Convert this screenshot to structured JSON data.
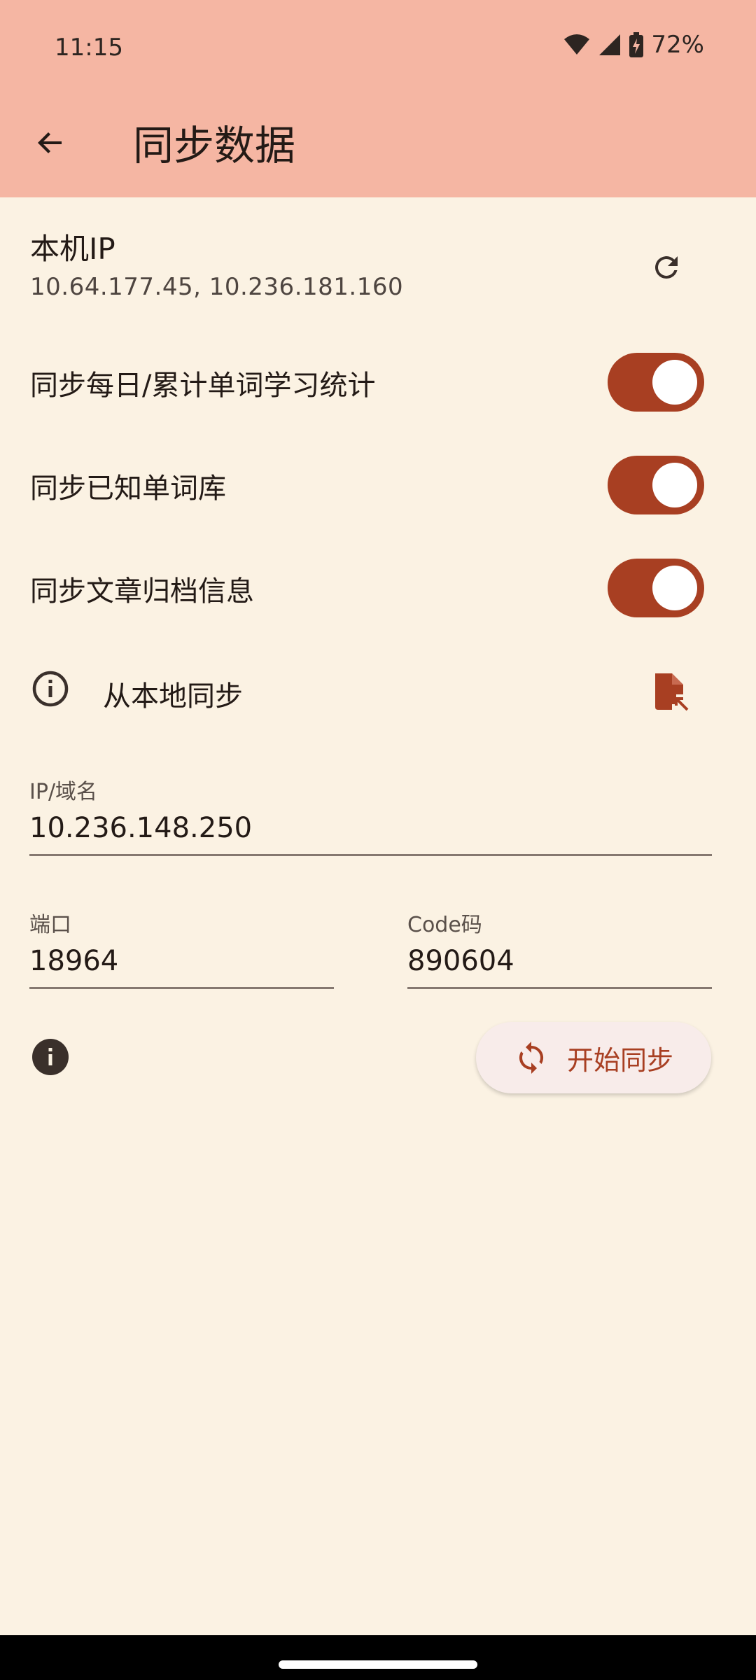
{
  "status_bar": {
    "time": "11:15",
    "battery": "72%",
    "icons": [
      "wifi-icon",
      "cellular-signal-icon",
      "battery-charging-icon"
    ]
  },
  "app_bar": {
    "title": "同步数据",
    "back_icon": "arrow-back-icon"
  },
  "local_ip": {
    "label": "本机IP",
    "value": "10.64.177.45, 10.236.181.160",
    "refresh_icon": "refresh-icon"
  },
  "switches": [
    {
      "label": "同步每日/累计单词学习统计",
      "on": true
    },
    {
      "label": "同步已知单词库",
      "on": true
    },
    {
      "label": "同步文章归档信息",
      "on": true
    }
  ],
  "local_sync": {
    "label": "从本地同步",
    "info_icon": "info-outline-icon",
    "file_icon": "file-import-icon"
  },
  "fields": {
    "host": {
      "label": "IP/域名",
      "value": "10.236.148.250"
    },
    "port": {
      "label": "端口",
      "value": "18964"
    },
    "code": {
      "label": "Code码",
      "value": "890604"
    }
  },
  "actions": {
    "info_icon": "info-filled-icon",
    "start_sync_label": "开始同步",
    "sync_icon": "sync-icon"
  },
  "colors": {
    "app_bar": "#f5b6a3",
    "background": "#fbf2e3",
    "accent": "#a83f22",
    "button_bg": "#f8ecea"
  }
}
